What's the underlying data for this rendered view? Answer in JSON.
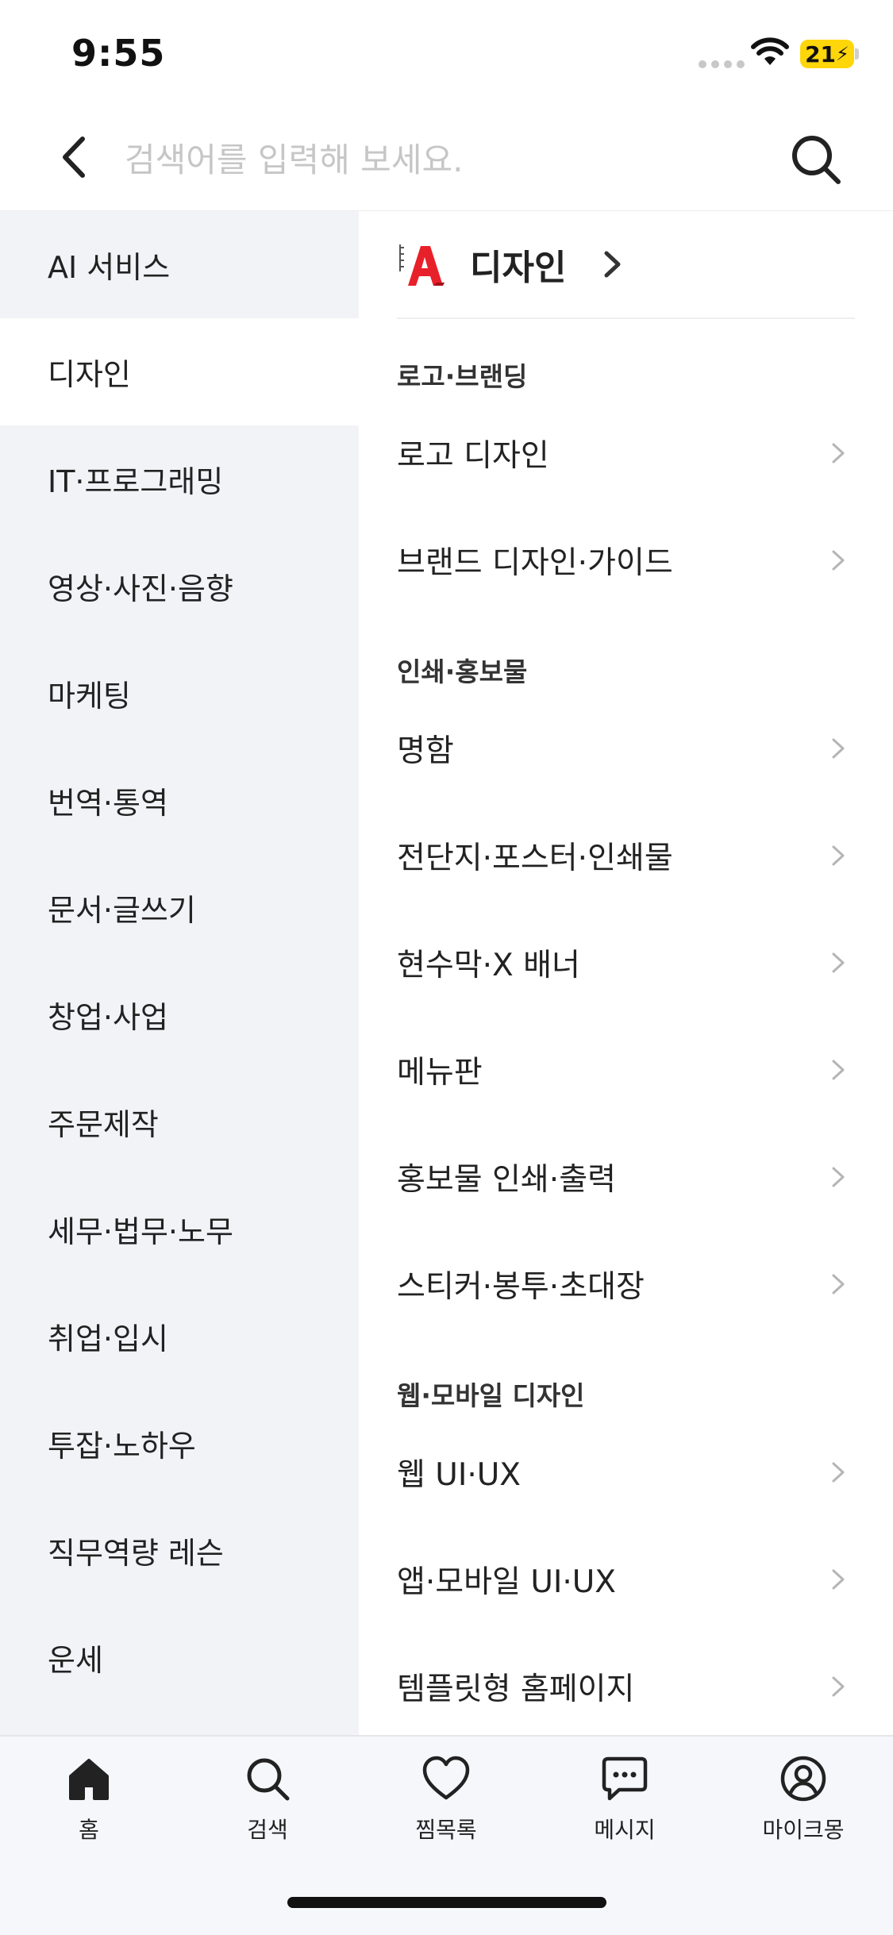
{
  "status_bar": {
    "time": "9:55",
    "battery": "21"
  },
  "search": {
    "placeholder": "검색어를 입력해 보세요."
  },
  "categories": [
    {
      "label": "AI 서비스"
    },
    {
      "label": "디자인",
      "selected": true
    },
    {
      "label": "IT·프로그래밍"
    },
    {
      "label": "영상·사진·음향"
    },
    {
      "label": "마케팅"
    },
    {
      "label": "번역·통역"
    },
    {
      "label": "문서·글쓰기"
    },
    {
      "label": "창업·사업"
    },
    {
      "label": "주문제작"
    },
    {
      "label": "세무·법무·노무"
    },
    {
      "label": "취업·입시"
    },
    {
      "label": "투잡·노하우"
    },
    {
      "label": "직무역량 레슨"
    },
    {
      "label": "운세"
    }
  ],
  "panel": {
    "title": "디자인",
    "groups": [
      {
        "title": "로고·브랜딩",
        "items": [
          "로고 디자인",
          "브랜드 디자인·가이드"
        ]
      },
      {
        "title": "인쇄·홍보물",
        "items": [
          "명함",
          "전단지·포스터·인쇄물",
          "현수막·X 배너",
          "메뉴판",
          "홍보물 인쇄·출력",
          "스티커·봉투·초대장"
        ]
      },
      {
        "title": "웹·모바일 디자인",
        "items": [
          "웹 UI·UX",
          "앱·모바일 UI·UX",
          "템플릿형 홈페이지"
        ]
      }
    ]
  },
  "tabs": [
    {
      "label": "홈",
      "icon": "home-icon"
    },
    {
      "label": "검색",
      "icon": "search-icon"
    },
    {
      "label": "찜목록",
      "icon": "heart-icon"
    },
    {
      "label": "메시지",
      "icon": "message-icon"
    },
    {
      "label": "마이크몽",
      "icon": "profile-icon"
    }
  ],
  "colors": {
    "accent_battery": "#ffd60a",
    "sidebar_bg": "#f2f3f7",
    "icon_red": "#e8202a"
  }
}
